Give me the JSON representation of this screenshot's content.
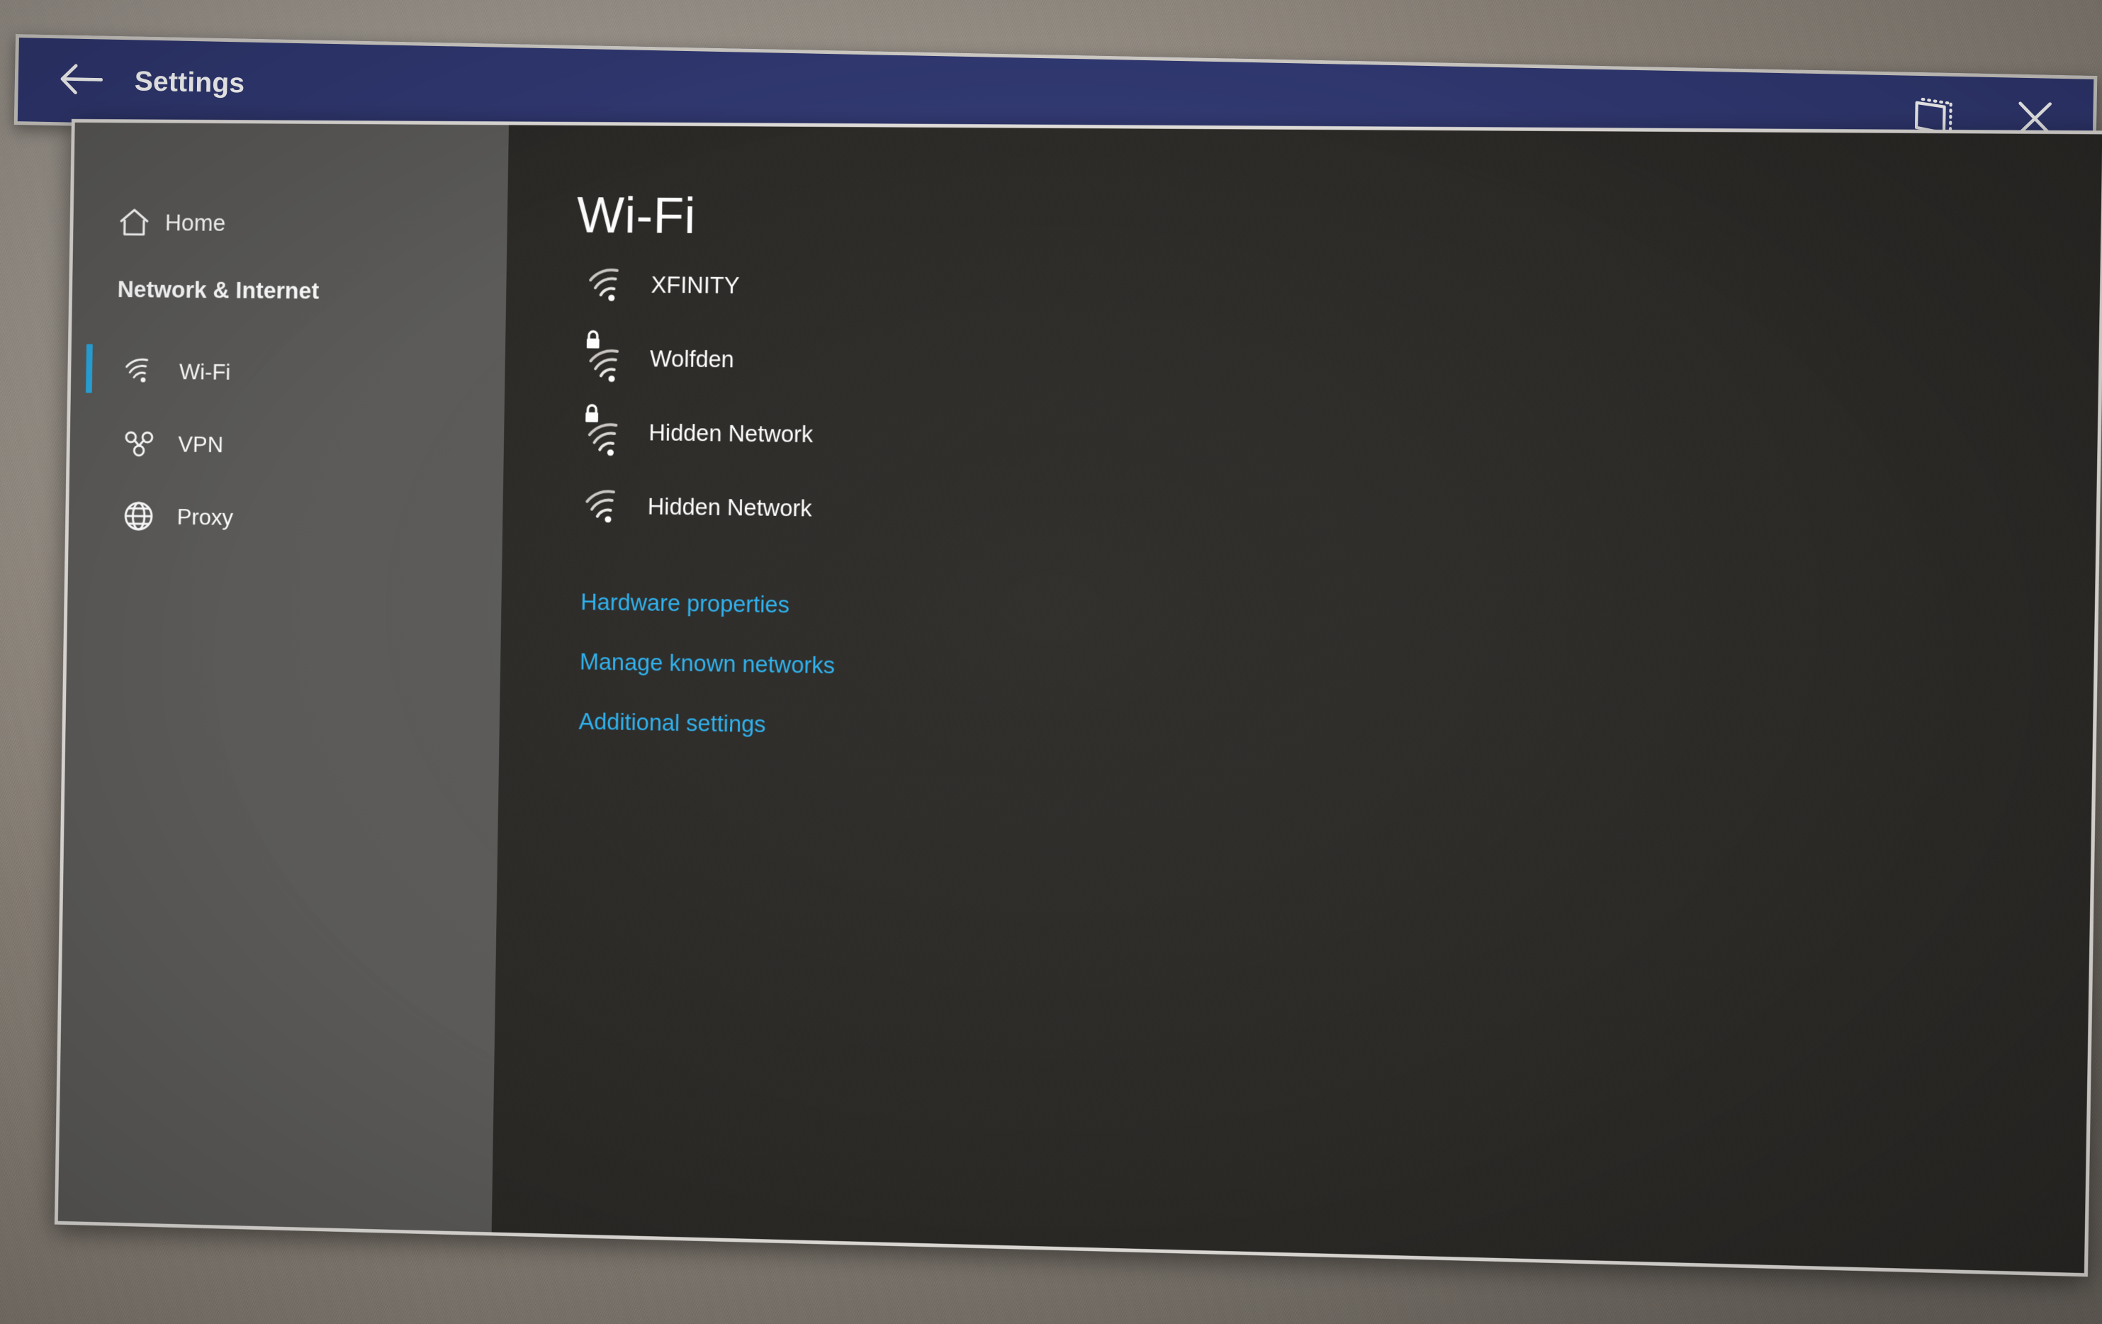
{
  "window": {
    "title": "Settings",
    "titlebar_color": "#313973",
    "border_color": "#e2dfdb",
    "back_icon": "back-arrow-icon",
    "follow_icon": "follow-me-icon",
    "close_icon": "close-icon"
  },
  "sidebar": {
    "background_color": "#5b5a58",
    "selection_accent_color": "#29a8e0",
    "home": {
      "label": "Home",
      "icon": "home-icon"
    },
    "group_title": "Network & Internet",
    "items": [
      {
        "label": "Wi-Fi",
        "icon": "wifi-icon",
        "selected": true
      },
      {
        "label": "VPN",
        "icon": "vpn-icon",
        "selected": false
      },
      {
        "label": "Proxy",
        "icon": "globe-icon",
        "selected": false
      }
    ]
  },
  "content": {
    "background_color": "#2b2926",
    "page_title": "Wi-Fi",
    "networks": [
      {
        "name": "XFINITY",
        "icon": "wifi-icon",
        "secured": false
      },
      {
        "name": "Wolfden",
        "icon": "wifi-icon",
        "secured": true
      },
      {
        "name": "Hidden Network",
        "icon": "wifi-icon",
        "secured": true
      },
      {
        "name": "Hidden Network",
        "icon": "wifi-icon",
        "secured": false
      }
    ],
    "link_color": "#2bb2f0",
    "links": [
      {
        "label": "Hardware properties"
      },
      {
        "label": "Manage known networks"
      },
      {
        "label": "Additional settings"
      }
    ]
  }
}
